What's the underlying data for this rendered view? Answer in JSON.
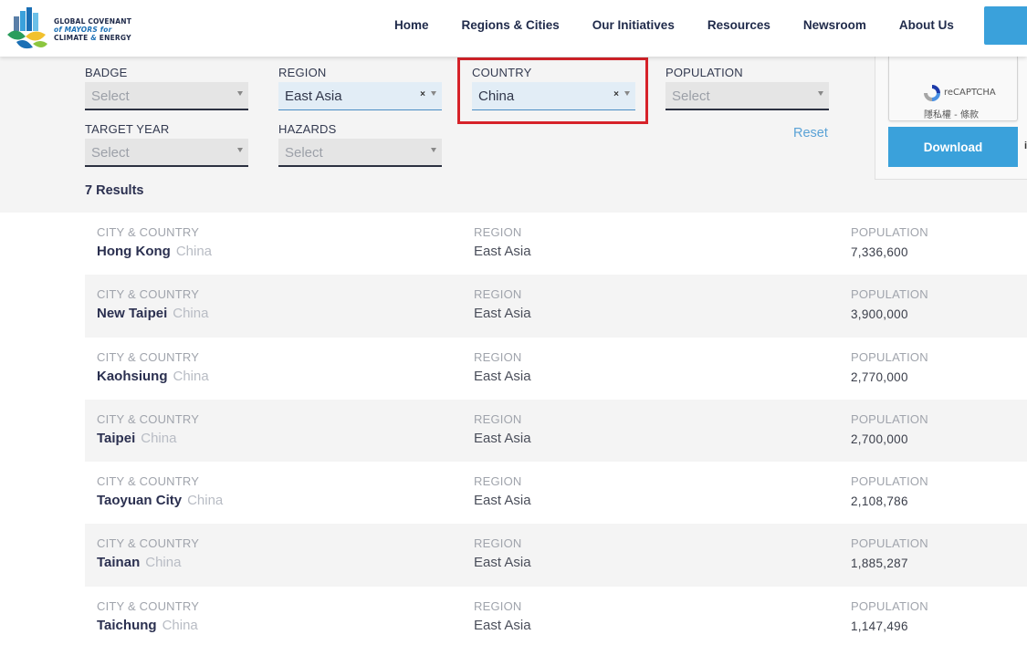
{
  "header": {
    "logo": {
      "line1": "GLOBAL COVENANT",
      "line2a": "of MAYORS",
      "line2b": "for",
      "line3a": "CLIMATE",
      "line3b": "&",
      "line3c": "ENERGY"
    },
    "nav": [
      "Home",
      "Regions & Cities",
      "Our Initiatives",
      "Resources",
      "Newsroom",
      "About Us"
    ]
  },
  "filters": {
    "badge": {
      "label": "BADGE",
      "value": "Select"
    },
    "region": {
      "label": "REGION",
      "value": "East Asia",
      "clear": "×"
    },
    "country": {
      "label": "COUNTRY",
      "value": "China",
      "clear": "×"
    },
    "population": {
      "label": "POPULATION",
      "value": "Select"
    },
    "target_year": {
      "label": "TARGET YEAR",
      "value": "Select"
    },
    "hazards": {
      "label": "HAZARDS",
      "value": "Select"
    },
    "reset_label": "Reset"
  },
  "results_count": "7 Results",
  "side": {
    "captcha_label": "reCAPTCHA",
    "captcha_links": "隱私權 - 條款",
    "download_label": "Download",
    "info": "i"
  },
  "columns": {
    "city": "CITY & COUNTRY",
    "region": "REGION",
    "population": "POPULATION"
  },
  "results": [
    {
      "city": "Hong Kong",
      "country": "China",
      "region": "East Asia",
      "population": "7,336,600"
    },
    {
      "city": "New Taipei",
      "country": "China",
      "region": "East Asia",
      "population": "3,900,000"
    },
    {
      "city": "Kaohsiung",
      "country": "China",
      "region": "East Asia",
      "population": "2,770,000"
    },
    {
      "city": "Taipei",
      "country": "China",
      "region": "East Asia",
      "population": "2,700,000"
    },
    {
      "city": "Taoyuan City",
      "country": "China",
      "region": "East Asia",
      "population": "2,108,786"
    },
    {
      "city": "Tainan",
      "country": "China",
      "region": "East Asia",
      "population": "1,885,287"
    },
    {
      "city": "Taichung",
      "country": "China",
      "region": "East Asia",
      "population": "1,147,496"
    }
  ],
  "colors": {
    "accent": "#3aa1db",
    "highlight": "#d62229",
    "navy": "#1f2a4a"
  }
}
